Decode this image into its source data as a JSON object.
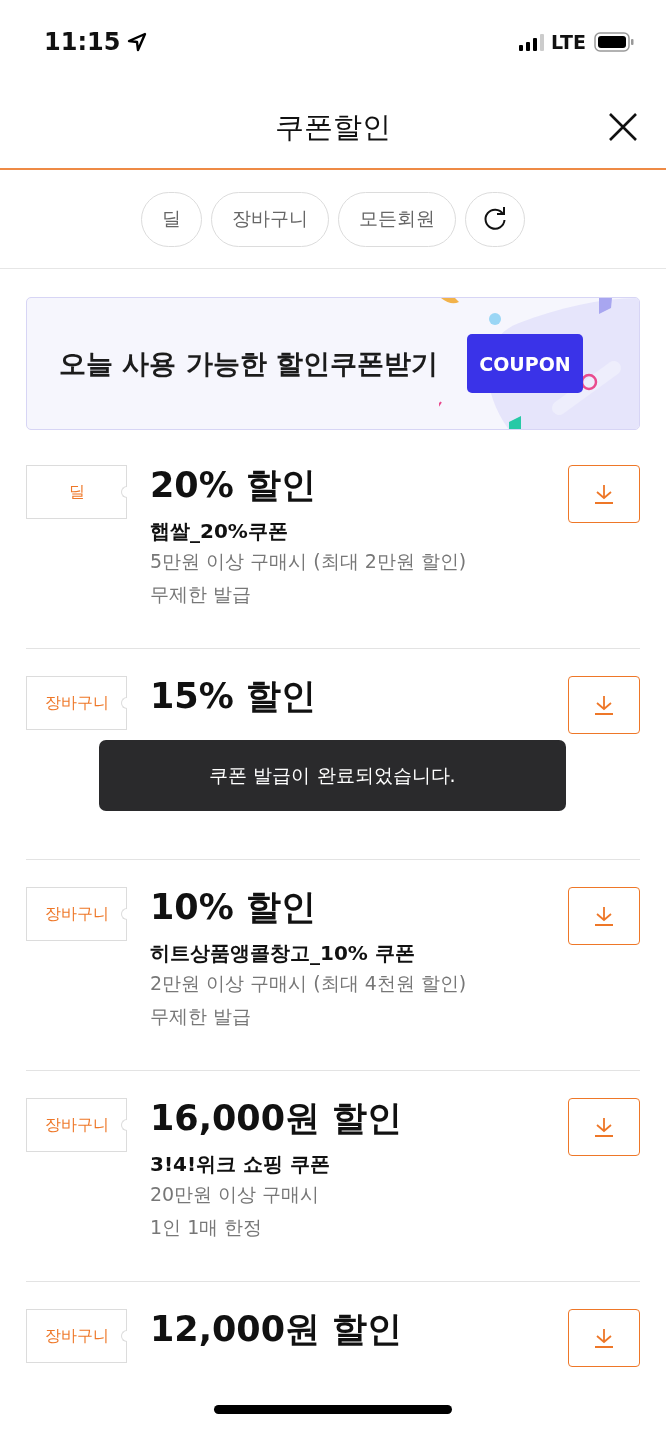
{
  "status_bar": {
    "time": "11:15",
    "network": "LTE"
  },
  "header": {
    "title": "쿠폰할인"
  },
  "filters": [
    {
      "label": "딜",
      "selected": false
    },
    {
      "label": "장바구니",
      "selected": false
    },
    {
      "label": "모든회원",
      "selected": false
    }
  ],
  "banner": {
    "title": "오늘 사용 가능한 할인쿠폰받기",
    "tag": "COUPON"
  },
  "coupons": [
    {
      "type": "딜",
      "discount": "20% 할인",
      "name": "햅쌀_20%쿠폰",
      "condition": "5만원 이상 구매시 (최대 2만원 할인)",
      "limit": "무제한 발급"
    },
    {
      "type": "장바구니",
      "discount": "15% 할인"
    },
    {
      "type": "장바구니",
      "discount": "10% 할인",
      "name": "히트상품앵콜창고_10% 쿠폰",
      "condition": "2만원 이상 구매시 (최대 4천원 할인)",
      "limit": "무제한 발급"
    },
    {
      "type": "장바구니",
      "discount": "16,000원 할인",
      "name": "3!4!위크 쇼핑 쿠폰",
      "condition": "20만원 이상 구매시",
      "limit": "1인 1매 한정"
    },
    {
      "type": "장바구니",
      "discount": "12,000원 할인"
    }
  ],
  "toast": {
    "message": "쿠폰 발급이 완료되었습니다."
  }
}
